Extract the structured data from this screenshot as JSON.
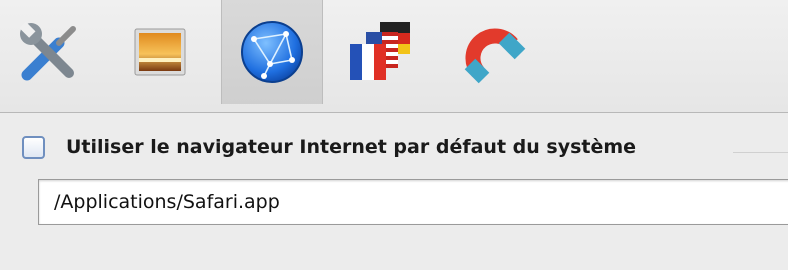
{
  "toolbar": {
    "items": [
      {
        "icon": "tools-icon",
        "selected": false
      },
      {
        "icon": "picture-icon",
        "selected": false
      },
      {
        "icon": "network-globe-icon",
        "selected": true
      },
      {
        "icon": "languages-flags-icon",
        "selected": false
      },
      {
        "icon": "magnet-icon",
        "selected": false
      }
    ]
  },
  "browser": {
    "use_default_label": "Utiliser le navigateur Internet par défaut du système",
    "use_default_checked": false,
    "path_value": "/Applications/Safari.app"
  }
}
